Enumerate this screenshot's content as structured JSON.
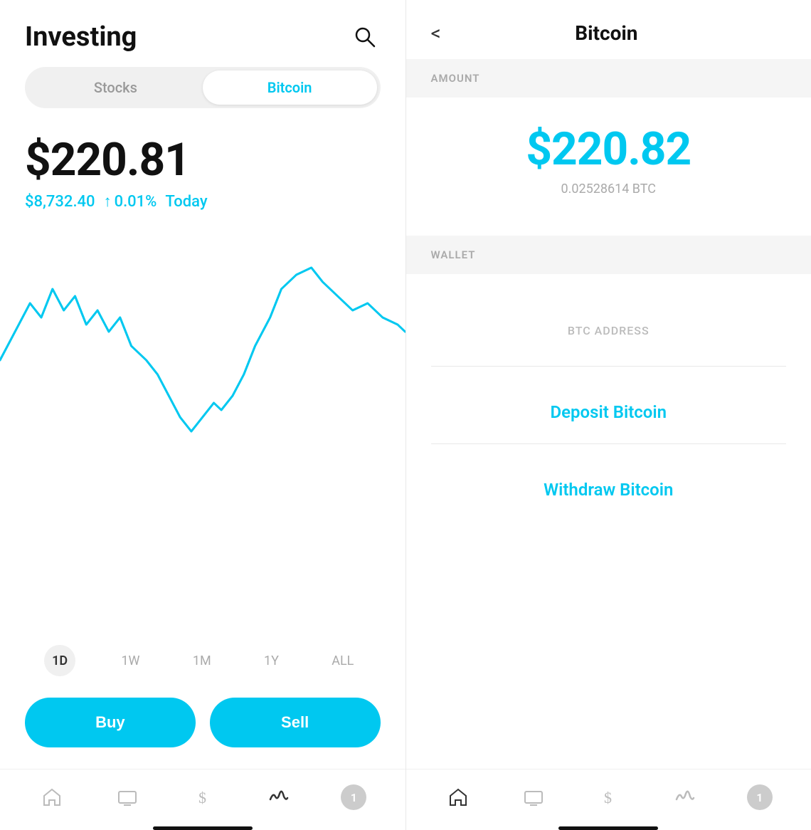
{
  "left": {
    "title": "Investing",
    "tabs": [
      {
        "label": "Stocks",
        "active": false
      },
      {
        "label": "Bitcoin",
        "active": true
      }
    ],
    "price": "$220.81",
    "price_btc": "$8,732.40",
    "price_change": "0.01%",
    "price_period": "Today",
    "time_filters": [
      "1D",
      "1W",
      "1M",
      "1Y",
      "ALL"
    ],
    "active_filter": "1D",
    "buy_label": "Buy",
    "sell_label": "Sell"
  },
  "right": {
    "title": "Bitcoin",
    "back_label": "<",
    "amount_section_label": "AMOUNT",
    "amount_usd": "$220.82",
    "amount_btc": "0.02528614 BTC",
    "wallet_section_label": "WALLET",
    "btc_address_label": "BTC ADDRESS",
    "deposit_label": "Deposit Bitcoin",
    "withdraw_label": "Withdraw Bitcoin"
  },
  "icons": {
    "search": "🔍",
    "home": "⌂",
    "tv": "▭",
    "dollar": "$",
    "activity": "∿",
    "badge": "1"
  }
}
